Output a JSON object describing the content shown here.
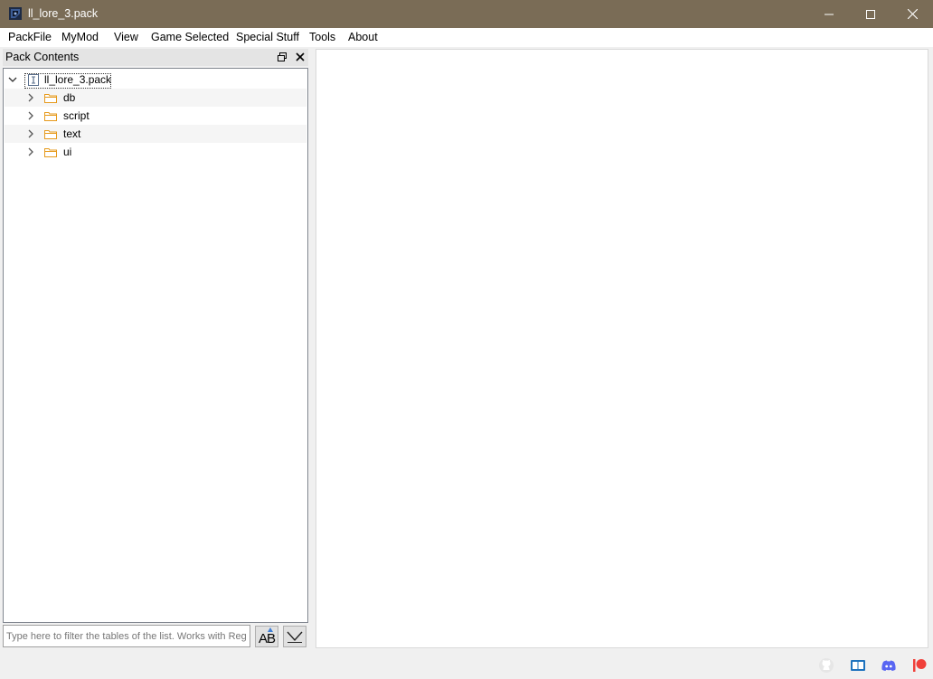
{
  "window": {
    "title": "ll_lore_3.pack",
    "colors": {
      "titlebar": "#7a6c56",
      "folder_icon": "#e69a1c",
      "discord": "#5865f2",
      "patreon": "#f0403a"
    }
  },
  "menu": {
    "items": [
      {
        "label": "PackFile"
      },
      {
        "label": "MyMod"
      },
      {
        "label": "View"
      },
      {
        "label": "Game Selected"
      },
      {
        "label": "Special Stuff"
      },
      {
        "label": "Tools"
      },
      {
        "label": "About"
      }
    ]
  },
  "dock": {
    "title": "Pack Contents"
  },
  "tree": {
    "root": {
      "label": "ll_lore_3.pack",
      "icon": "pack-file-icon",
      "expanded": true
    },
    "children": [
      {
        "label": "db",
        "icon": "folder-icon",
        "expanded": false
      },
      {
        "label": "script",
        "icon": "folder-icon",
        "expanded": false
      },
      {
        "label": "text",
        "icon": "folder-icon",
        "expanded": false
      },
      {
        "label": "ui",
        "icon": "folder-icon",
        "expanded": false
      }
    ]
  },
  "filter": {
    "placeholder": "Type here to filter the tables of the list. Works with Regex too!",
    "value": "",
    "case_button_label": "AB"
  },
  "status_icons": [
    "github-icon",
    "manual-book-icon",
    "discord-icon",
    "patreon-icon"
  ]
}
